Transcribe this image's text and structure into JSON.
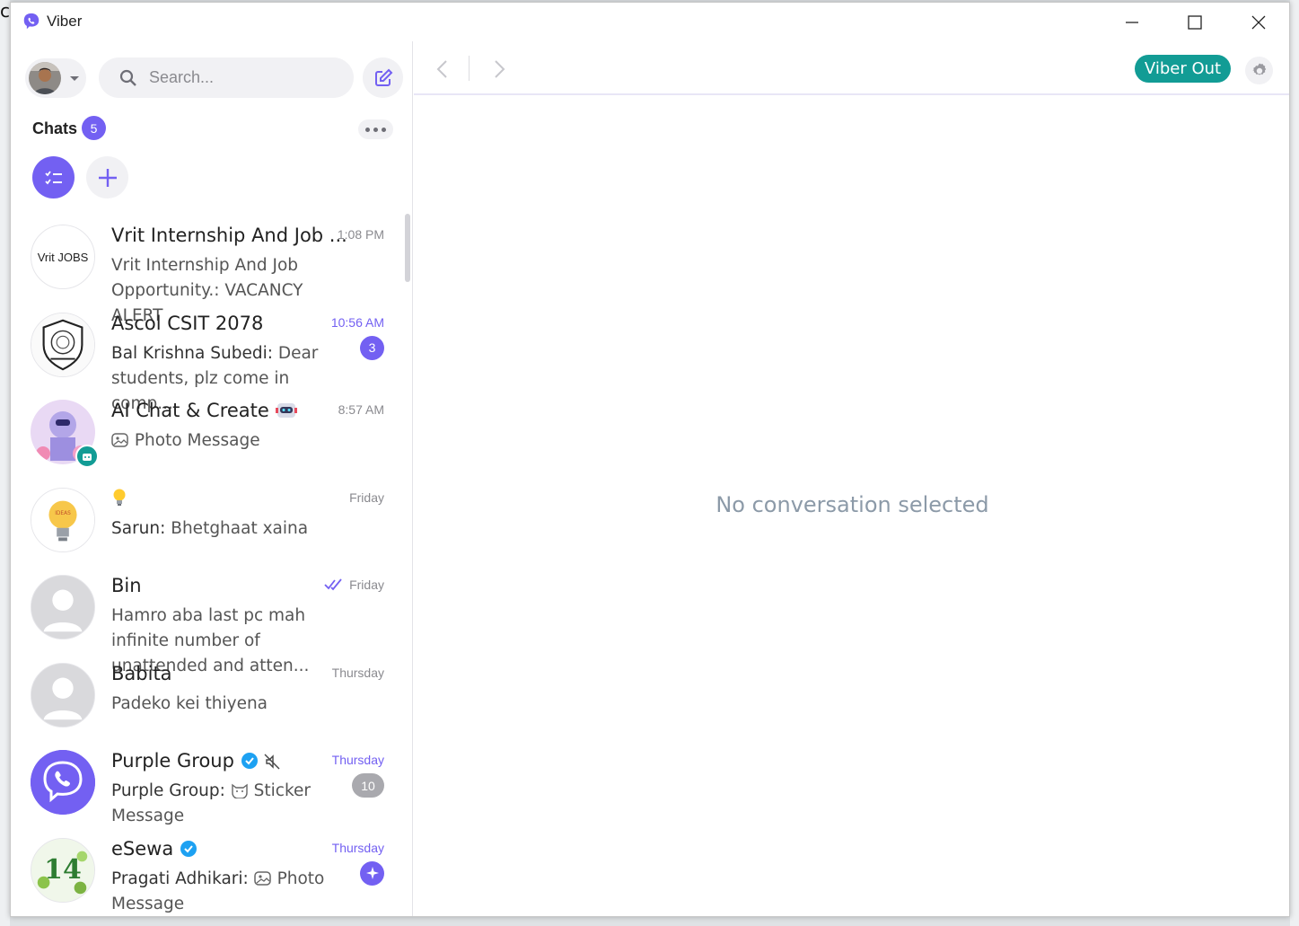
{
  "window": {
    "title": "Viber"
  },
  "sidebar": {
    "search_placeholder": "Search...",
    "chats_label": "Chats",
    "chats_count": "5"
  },
  "chats": [
    {
      "name": "Vrit Internship And Job ...",
      "time": "1:08 PM",
      "time_highlight": false,
      "sender": "",
      "message": "Vrit Internship And Job Opportunity.: VACANCY ALERT",
      "avatar_text": "Vrit JOBS",
      "badge": ""
    },
    {
      "name": "Ascol CSIT 2078",
      "time": "10:56 AM",
      "time_highlight": true,
      "sender": "Bal Krishna Subedi:",
      "message": "Dear students, plz come in comp...",
      "badge": "3"
    },
    {
      "name": "AI Chat & Create",
      "name_icon": "robot-emoji",
      "time": "8:57 AM",
      "time_highlight": false,
      "sender": "",
      "message": "Photo Message",
      "message_icon": "photo-icon",
      "badge": ""
    },
    {
      "name": "",
      "name_icon": "lightbulb-emoji",
      "time": "Friday",
      "time_highlight": false,
      "sender": "Sarun:",
      "message": "Bhetghaat xaina",
      "badge": ""
    },
    {
      "name": "Bin",
      "time": "Friday",
      "time_highlight": false,
      "read_ticks": true,
      "sender": "",
      "message": "Hamro aba last pc mah infinite number of unattended and atten...",
      "badge": ""
    },
    {
      "name": "Babita",
      "time": "Thursday",
      "time_highlight": false,
      "sender": "",
      "message": "Padeko kei thiyena",
      "badge": ""
    },
    {
      "name": "Purple Group",
      "verified": true,
      "muted": true,
      "time": "Thursday",
      "time_highlight": true,
      "sender": "Purple Group:",
      "message": "Sticker Message",
      "message_icon": "sticker-icon",
      "badge": "10"
    },
    {
      "name": "eSewa",
      "verified": true,
      "time": "Thursday",
      "time_highlight": true,
      "sender": "Pragati Adhikari:",
      "message": "Photo Message",
      "message_icon": "photo-icon",
      "badge": "",
      "avatar_text": "14"
    }
  ],
  "main": {
    "viber_out_label": "Viber Out",
    "empty_text": "No conversation selected"
  },
  "colors": {
    "accent": "#7360f2",
    "viber_out": "#129c95",
    "empty_text": "#8c9aa8"
  }
}
